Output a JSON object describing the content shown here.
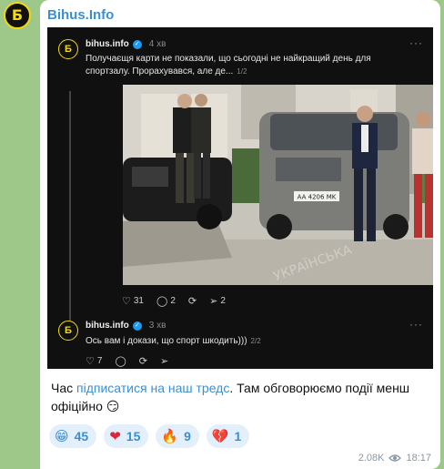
{
  "channel": {
    "avatar_glyph": "Б",
    "name": "Bihus.Info"
  },
  "embed": {
    "posts": [
      {
        "author": "bihus.info",
        "verified_icon": "✓",
        "time": "4 хв",
        "more": "···",
        "text_line1": "Получаєщя карти не показали, що сьогодні не найкращий день для",
        "text_line2": "спортзалу. Прорахувався, але де...",
        "counter": "1/2",
        "photo_plate": "AA 4206 MK",
        "photo_watermark": "УКРАЇНСЬКА",
        "stats": {
          "likes": "31",
          "comments": "2",
          "reposts": "",
          "shares": "2"
        }
      },
      {
        "author": "bihus.info",
        "verified_icon": "✓",
        "time": "3 хв",
        "more": "···",
        "text_line1": "Ось вам і докази, що спорт шкодить)))",
        "counter": "2/2",
        "stats": {
          "likes": "7",
          "comments": "",
          "reposts": "",
          "shares": ""
        }
      }
    ]
  },
  "caption": {
    "before": "Час ",
    "link": "підписатися на наш тредс",
    "after": ". Там обговорюємо події менш офіційно ",
    "emoji": "😏"
  },
  "reactions": [
    {
      "emoji": "😁",
      "count": "45"
    },
    {
      "emoji": "❤",
      "count": "15"
    },
    {
      "emoji": "🔥",
      "count": "9"
    },
    {
      "emoji": "💔",
      "count": "1"
    }
  ],
  "meta": {
    "views": "2.08K",
    "time": "18:17"
  },
  "colors": {
    "accent": "#3a8fd4",
    "embed_bg": "#101010",
    "logo_yellow": "#f5d90a",
    "chat_bg": "#9ec78a"
  }
}
